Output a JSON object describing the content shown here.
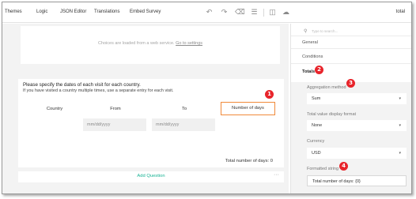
{
  "toolbar": {
    "tabs": [
      "Themes",
      "Logic",
      "JSON Editor",
      "Translations",
      "Embed Survey"
    ],
    "title": "total",
    "icons": [
      "undo-icon",
      "redo-icon",
      "eraser-icon",
      "settings-sliders-icon",
      "book-icon",
      "cloud-save-icon"
    ]
  },
  "canvas": {
    "choices_note": "Choices are loaded from a web service.",
    "choices_link": "Go to settings",
    "question": {
      "title": "Please specify the dates of each visit for each country.",
      "description": "If you have visited a country multiple times, use a separate entry for each visit.",
      "columns": [
        "Country",
        "From",
        "To",
        "Number of days"
      ],
      "row": {
        "from_placeholder": "mm/dd/yyyy",
        "to_placeholder": "mm/dd/yyyy"
      },
      "total_text": "Total number of days: 0"
    },
    "add_question": "Add Question",
    "more_icon": "···"
  },
  "properties": {
    "search_placeholder": "Type to search...",
    "categories": [
      "General",
      "Conditions",
      "Totals"
    ],
    "aggregation_label": "Aggregation method",
    "aggregation_value": "Sum",
    "display_style_label": "Total value display format",
    "display_style_value": "None",
    "currency_label": "Currency",
    "currency_value": "USD",
    "format_label": "Formatted string",
    "format_value": "Total number of days: {0}"
  },
  "badges": [
    "1",
    "2",
    "3",
    "4"
  ],
  "colors": {
    "accent": "#19b394",
    "highlight_border": "#f08a3a",
    "badge": "#e8242b"
  }
}
